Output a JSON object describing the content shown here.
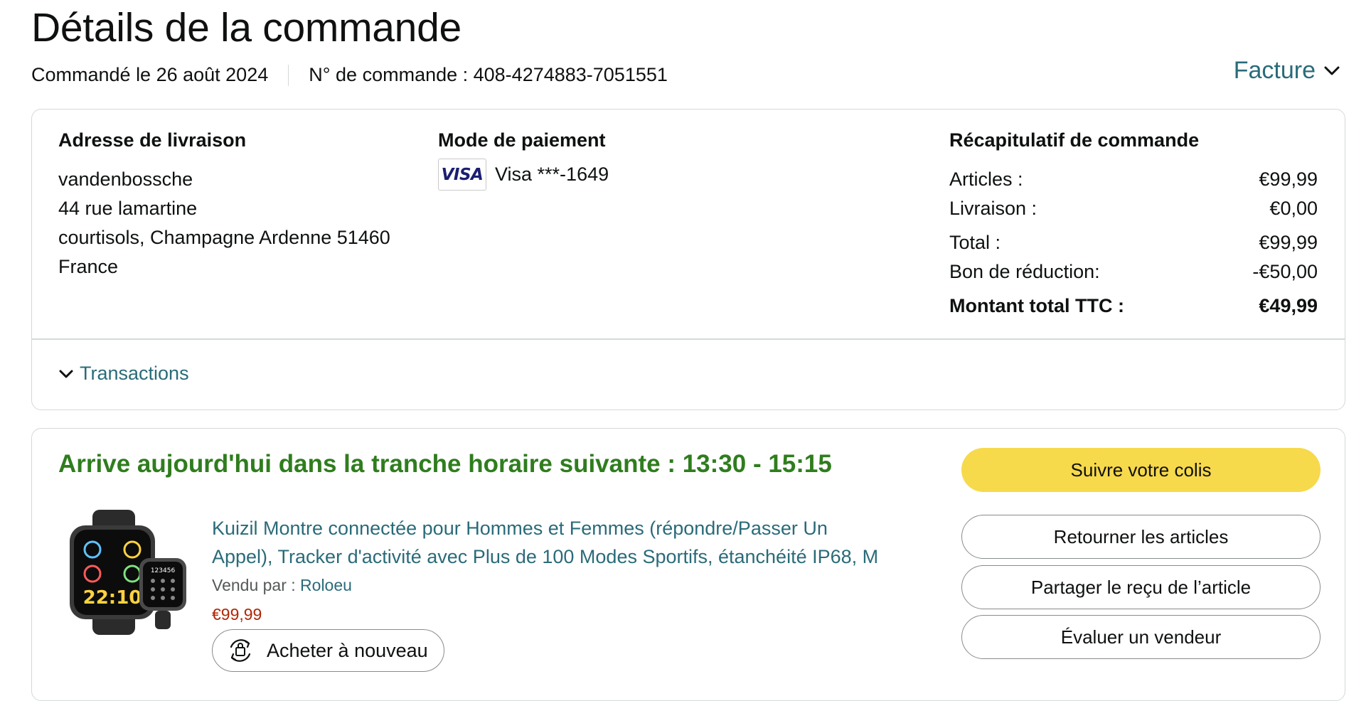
{
  "page": {
    "title": "Détails de la commande",
    "order_date": "Commandé le 26 août 2024",
    "order_number": "N° de commande : 408-4274883-7051551",
    "invoice_label": "Facture"
  },
  "shipping": {
    "heading": "Adresse de livraison",
    "name": "vandenbossche",
    "street": "44 rue lamartine",
    "city": "courtisols, Champagne Ardenne 51460",
    "country": "France"
  },
  "payment": {
    "heading": "Mode de paiement",
    "card_brand": "VISA",
    "card_text": "Visa ***-1649"
  },
  "summary": {
    "heading": "Récapitulatif de commande",
    "rows": [
      {
        "label": "Articles :",
        "value": "€99,99"
      },
      {
        "label": "Livraison :",
        "value": "€0,00"
      },
      {
        "label": "Total :",
        "value": "€99,99"
      },
      {
        "label": "Bon de réduction:",
        "value": "-€50,00"
      },
      {
        "label": "Montant total TTC :",
        "value": "€49,99"
      }
    ]
  },
  "transactions_label": "Transactions",
  "shipment": {
    "arrival_text": "Arrive aujourd'hui dans la tranche horaire suivante : 13:30 - 15:15",
    "product_title_line1": "Kuizil Montre connectée pour Hommes et Femmes (répondre/Passer Un",
    "product_title_line2": "Appel), Tracker d'activité avec Plus de 100 Modes Sportifs, étanchéité IP68, M",
    "seller_prefix": "Vendu par : ",
    "seller_name": "Roloeu",
    "price": "€99,99",
    "buy_again_label": "Acheter à nouveau",
    "watch_time": "22:10",
    "watch_small_time": "123456",
    "buttons": {
      "track": "Suivre votre colis",
      "return": "Retourner les articles",
      "share": "Partager le reçu de l’article",
      "rate": "Évaluer un vendeur"
    }
  },
  "colors": {
    "link": "#2a6b79",
    "arrival_green": "#2f7d1e",
    "price_red": "#b12704",
    "primary_button": "#f7d94c",
    "border": "#d5d9d9"
  },
  "icons": {
    "invoice": "chevron-down-icon",
    "transactions": "chevron-down-icon",
    "buy_again": "buy-again-cycle-icon"
  }
}
